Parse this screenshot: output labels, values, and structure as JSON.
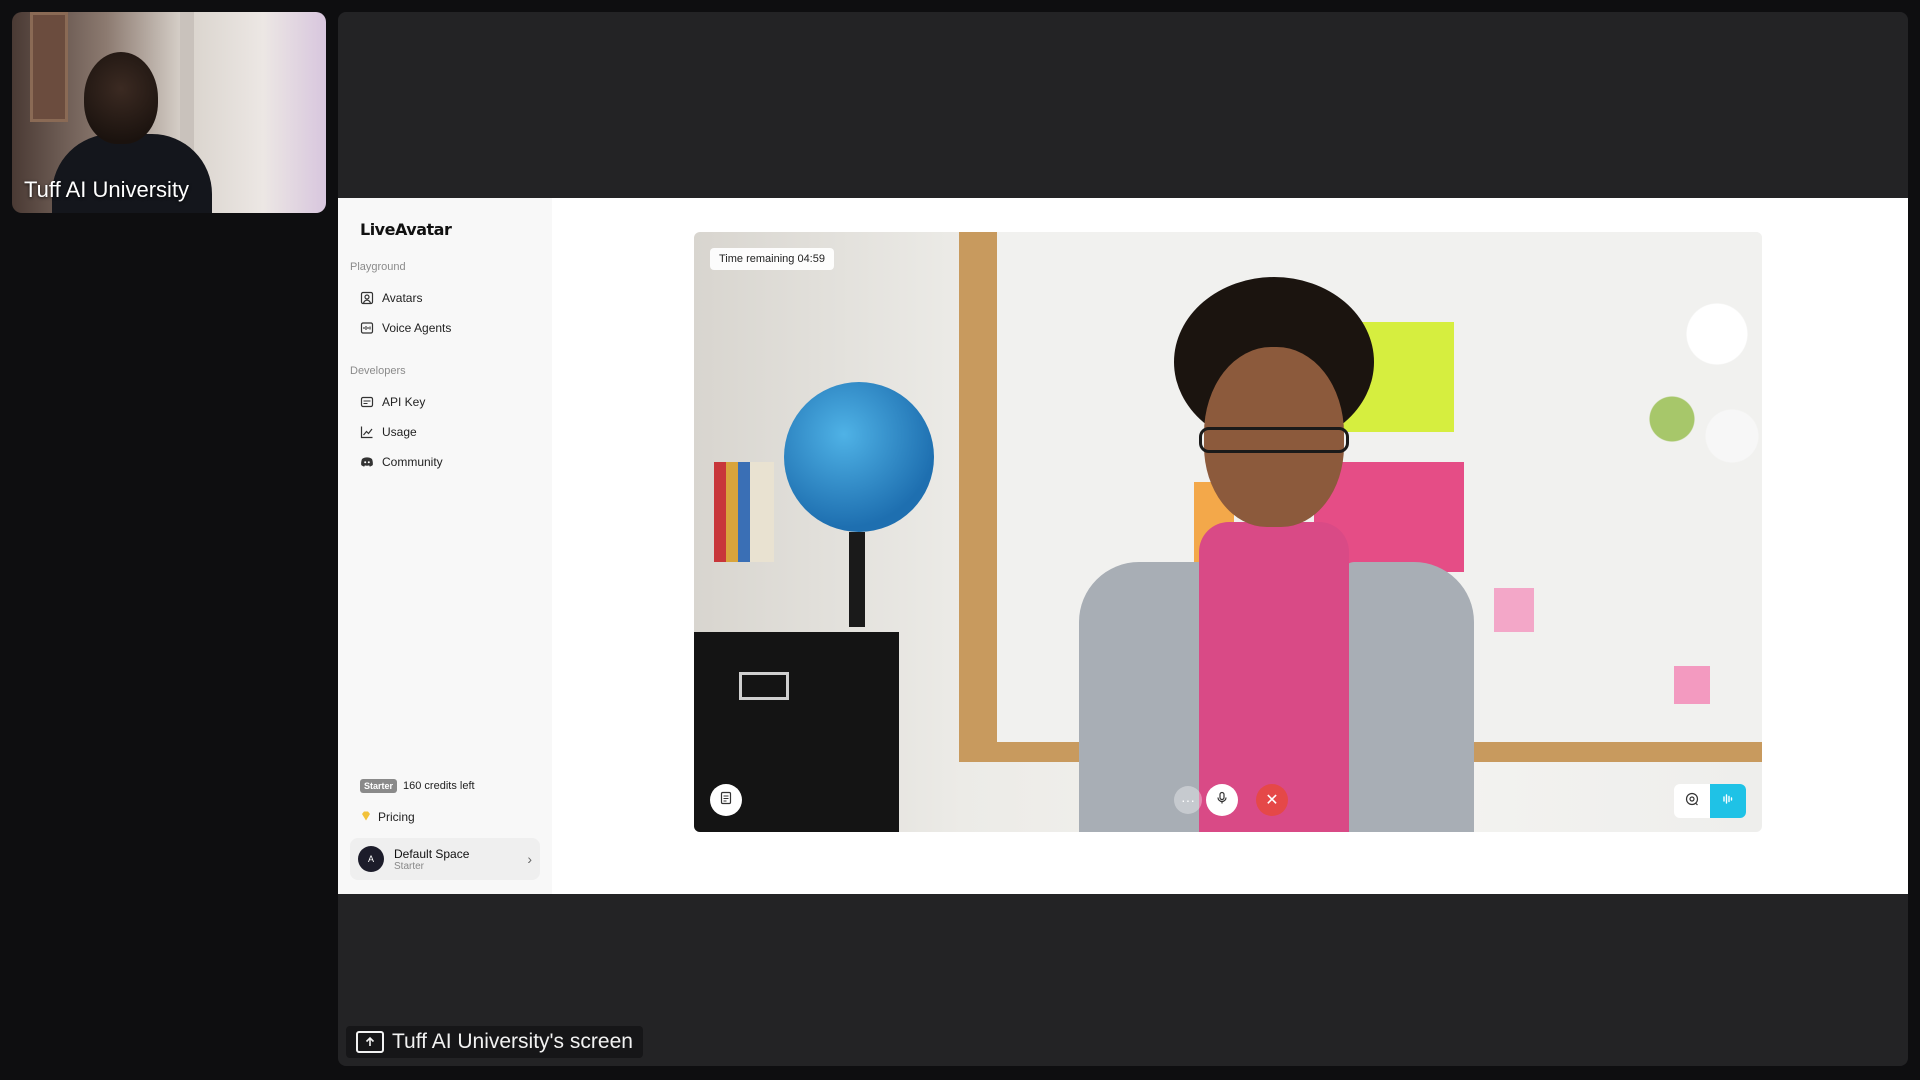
{
  "participant": {
    "name": "Tuff AI University"
  },
  "share": {
    "label": "Tuff AI University's screen"
  },
  "app": {
    "logo": "LiveAvatar",
    "sidebar": {
      "sections": [
        {
          "label": "Playground",
          "items": [
            {
              "label": "Avatars",
              "icon": "avatar-icon"
            },
            {
              "label": "Voice Agents",
              "icon": "voice-agent-icon"
            }
          ]
        },
        {
          "label": "Developers",
          "items": [
            {
              "label": "API Key",
              "icon": "key-icon"
            },
            {
              "label": "Usage",
              "icon": "chart-icon"
            },
            {
              "label": "Community",
              "icon": "discord-icon"
            }
          ]
        }
      ],
      "plan_badge": "Starter",
      "credits": "160 credits left",
      "pricing": "Pricing",
      "space": {
        "initial": "A",
        "name": "Default Space",
        "plan": "Starter"
      }
    },
    "session": {
      "timer": "Time remaining 04:59",
      "controls": {
        "more": "···",
        "end": "✕"
      },
      "accent_color": "#1fc2e6",
      "end_color": "#e54848"
    }
  }
}
